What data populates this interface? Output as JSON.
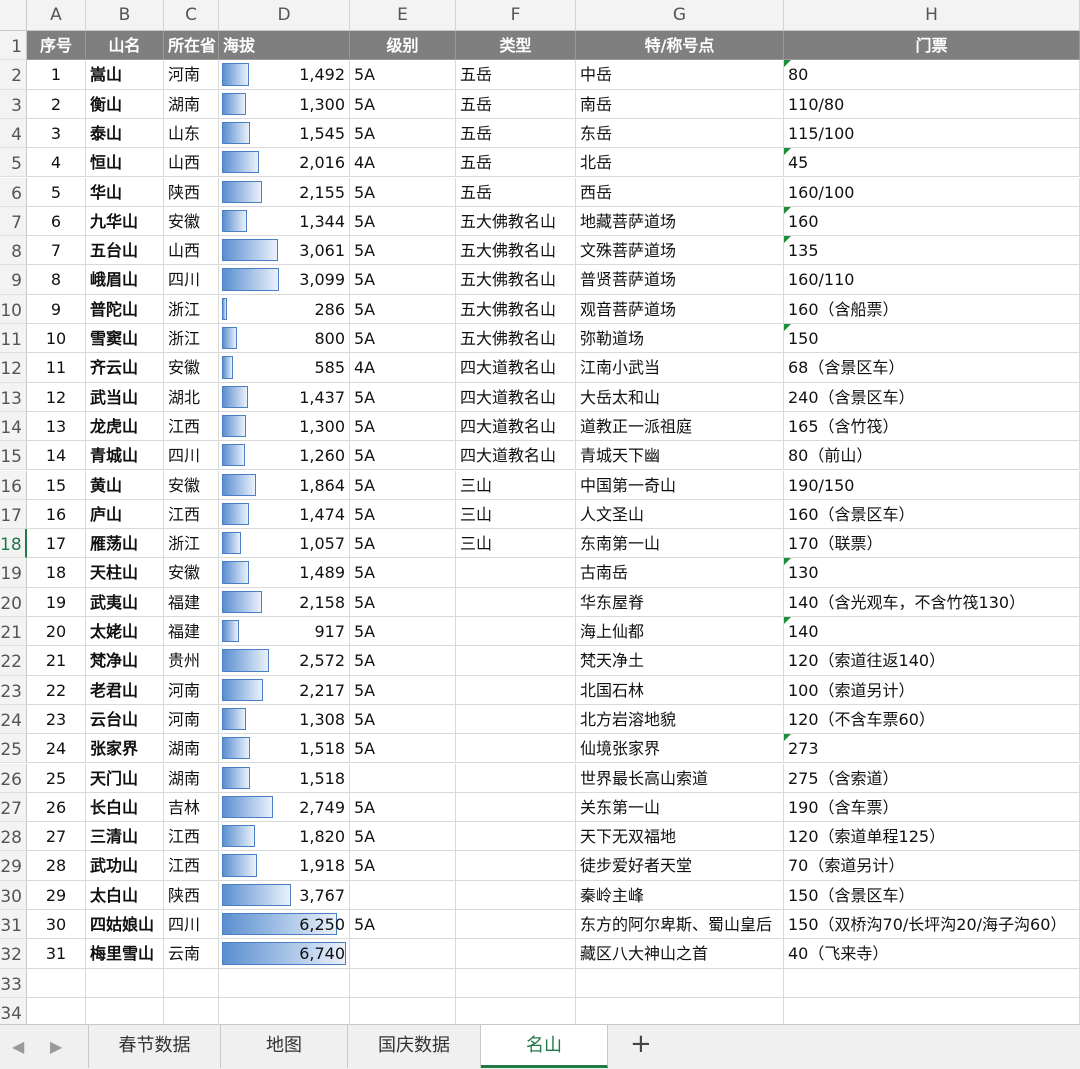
{
  "columns": [
    "A",
    "B",
    "C",
    "D",
    "E",
    "F",
    "G",
    "H"
  ],
  "headers": [
    "序号",
    "山名",
    "所在省",
    "海拔",
    "级别",
    "类型",
    "特/称号点",
    "门票"
  ],
  "rows": [
    {
      "n": "1",
      "name": "嵩山",
      "prov": "河南",
      "alt": "1,492",
      "alt_value": 1492,
      "level": "5A",
      "type": "五岳",
      "title": "中岳",
      "ticket": "80",
      "note": true
    },
    {
      "n": "2",
      "name": "衡山",
      "prov": "湖南",
      "alt": "1,300",
      "alt_value": 1300,
      "level": "5A",
      "type": "五岳",
      "title": "南岳",
      "ticket": "110/80",
      "note": false
    },
    {
      "n": "3",
      "name": "泰山",
      "prov": "山东",
      "alt": "1,545",
      "alt_value": 1545,
      "level": "5A",
      "type": "五岳",
      "title": "东岳",
      "ticket": "115/100",
      "note": false
    },
    {
      "n": "4",
      "name": "恒山",
      "prov": "山西",
      "alt": "2,016",
      "alt_value": 2016,
      "level": "4A",
      "type": "五岳",
      "title": "北岳",
      "ticket": "45",
      "note": true
    },
    {
      "n": "5",
      "name": "华山",
      "prov": "陕西",
      "alt": "2,155",
      "alt_value": 2155,
      "level": "5A",
      "type": "五岳",
      "title": "西岳",
      "ticket": "160/100",
      "note": false
    },
    {
      "n": "6",
      "name": "九华山",
      "prov": "安徽",
      "alt": "1,344",
      "alt_value": 1344,
      "level": "5A",
      "type": "五大佛教名山",
      "title": "地藏菩萨道场",
      "ticket": "160",
      "note": true
    },
    {
      "n": "7",
      "name": "五台山",
      "prov": "山西",
      "alt": "3,061",
      "alt_value": 3061,
      "level": "5A",
      "type": "五大佛教名山",
      "title": "文殊菩萨道场",
      "ticket": "135",
      "note": true
    },
    {
      "n": "8",
      "name": "峨眉山",
      "prov": "四川",
      "alt": "3,099",
      "alt_value": 3099,
      "level": "5A",
      "type": "五大佛教名山",
      "title": "普贤菩萨道场",
      "ticket": "160/110",
      "note": false
    },
    {
      "n": "9",
      "name": "普陀山",
      "prov": "浙江",
      "alt": "286",
      "alt_value": 286,
      "level": "5A",
      "type": "五大佛教名山",
      "title": "观音菩萨道场",
      "ticket": "160（含船票）",
      "note": false
    },
    {
      "n": "10",
      "name": "雪窦山",
      "prov": "浙江",
      "alt": "800",
      "alt_value": 800,
      "level": "5A",
      "type": "五大佛教名山",
      "title": "弥勒道场",
      "ticket": "150",
      "note": true
    },
    {
      "n": "11",
      "name": "齐云山",
      "prov": "安徽",
      "alt": "585",
      "alt_value": 585,
      "level": "4A",
      "type": "四大道教名山",
      "title": "江南小武当",
      "ticket": "68（含景区车）",
      "note": false
    },
    {
      "n": "12",
      "name": "武当山",
      "prov": "湖北",
      "alt": "1,437",
      "alt_value": 1437,
      "level": "5A",
      "type": "四大道教名山",
      "title": "大岳太和山",
      "ticket": "240（含景区车）",
      "note": false
    },
    {
      "n": "13",
      "name": "龙虎山",
      "prov": "江西",
      "alt": "1,300",
      "alt_value": 1300,
      "level": "5A",
      "type": "四大道教名山",
      "title": "道教正一派祖庭",
      "ticket": "165（含竹筏）",
      "note": false
    },
    {
      "n": "14",
      "name": "青城山",
      "prov": "四川",
      "alt": "1,260",
      "alt_value": 1260,
      "level": "5A",
      "type": "四大道教名山",
      "title": "青城天下幽",
      "ticket": "80（前山）",
      "note": false
    },
    {
      "n": "15",
      "name": "黄山",
      "prov": "安徽",
      "alt": "1,864",
      "alt_value": 1864,
      "level": "5A",
      "type": "三山",
      "title": "中国第一奇山",
      "ticket": "190/150",
      "note": false
    },
    {
      "n": "16",
      "name": "庐山",
      "prov": "江西",
      "alt": "1,474",
      "alt_value": 1474,
      "level": "5A",
      "type": "三山",
      "title": "人文圣山",
      "ticket": "160（含景区车）",
      "note": false
    },
    {
      "n": "17",
      "name": "雁荡山",
      "prov": "浙江",
      "alt": "1,057",
      "alt_value": 1057,
      "level": "5A",
      "type": "三山",
      "title": "东南第一山",
      "ticket": "170（联票）",
      "note": false
    },
    {
      "n": "18",
      "name": "天柱山",
      "prov": "安徽",
      "alt": "1,489",
      "alt_value": 1489,
      "level": "5A",
      "type": "",
      "title": "古南岳",
      "ticket": "130",
      "note": true
    },
    {
      "n": "19",
      "name": "武夷山",
      "prov": "福建",
      "alt": "2,158",
      "alt_value": 2158,
      "level": "5A",
      "type": "",
      "title": "华东屋脊",
      "ticket": "140（含光观车，不含竹筏130）",
      "note": false
    },
    {
      "n": "20",
      "name": "太姥山",
      "prov": "福建",
      "alt": "917",
      "alt_value": 917,
      "level": "5A",
      "type": "",
      "title": "海上仙都",
      "ticket": "140",
      "note": true
    },
    {
      "n": "21",
      "name": "梵净山",
      "prov": "贵州",
      "alt": "2,572",
      "alt_value": 2572,
      "level": "5A",
      "type": "",
      "title": "梵天净土",
      "ticket": "120（索道往返140）",
      "note": false
    },
    {
      "n": "22",
      "name": "老君山",
      "prov": "河南",
      "alt": "2,217",
      "alt_value": 2217,
      "level": "5A",
      "type": "",
      "title": "北国石林",
      "ticket": "100（索道另计）",
      "note": false
    },
    {
      "n": "23",
      "name": "云台山",
      "prov": "河南",
      "alt": "1,308",
      "alt_value": 1308,
      "level": "5A",
      "type": "",
      "title": "北方岩溶地貌",
      "ticket": "120（不含车票60）",
      "note": false
    },
    {
      "n": "24",
      "name": "张家界",
      "prov": "湖南",
      "alt": "1,518",
      "alt_value": 1518,
      "level": "5A",
      "type": "",
      "title": "仙境张家界",
      "ticket": "273",
      "note": true
    },
    {
      "n": "25",
      "name": "天门山",
      "prov": "湖南",
      "alt": "1,518",
      "alt_value": 1518,
      "level": "",
      "type": "",
      "title": "世界最长高山索道",
      "ticket": "275（含索道）",
      "note": false
    },
    {
      "n": "26",
      "name": "长白山",
      "prov": "吉林",
      "alt": "2,749",
      "alt_value": 2749,
      "level": "5A",
      "type": "",
      "title": "关东第一山",
      "ticket": "190（含车票）",
      "note": false
    },
    {
      "n": "27",
      "name": "三清山",
      "prov": "江西",
      "alt": "1,820",
      "alt_value": 1820,
      "level": "5A",
      "type": "",
      "title": "天下无双福地",
      "ticket": "120（索道单程125）",
      "note": false
    },
    {
      "n": "28",
      "name": "武功山",
      "prov": "江西",
      "alt": "1,918",
      "alt_value": 1918,
      "level": "5A",
      "type": "",
      "title": "徒步爱好者天堂",
      "ticket": "70（索道另计）",
      "note": false
    },
    {
      "n": "29",
      "name": "太白山",
      "prov": "陕西",
      "alt": "3,767",
      "alt_value": 3767,
      "level": "",
      "type": "",
      "title": "秦岭主峰",
      "ticket": "150（含景区车）",
      "note": false
    },
    {
      "n": "30",
      "name": "四姑娘山",
      "prov": "四川",
      "alt": "6,250",
      "alt_value": 6250,
      "level": "5A",
      "type": "",
      "title": "东方的阿尔卑斯、蜀山皇后",
      "ticket": "150（双桥沟70/长坪沟20/海子沟60）",
      "note": false
    },
    {
      "n": "31",
      "name": "梅里雪山",
      "prov": "云南",
      "alt": "6,740",
      "alt_value": 6740,
      "level": "",
      "type": "",
      "title": "藏区八大神山之首",
      "ticket": "40（飞来寺）",
      "note": false
    }
  ],
  "altitude_bar_max": 6740,
  "selected_row": 18,
  "tabs": [
    "春节数据",
    "地图",
    "国庆数据",
    "名山"
  ],
  "active_tab": "名山",
  "add_tab_label": "+",
  "nav_prev": "◀",
  "nav_next": "▶",
  "colors": {
    "header_bg": "#7f7f7f",
    "bar": "#5b8fd0",
    "accent": "#1f7a45",
    "note_marker": "#1e8c3a"
  }
}
